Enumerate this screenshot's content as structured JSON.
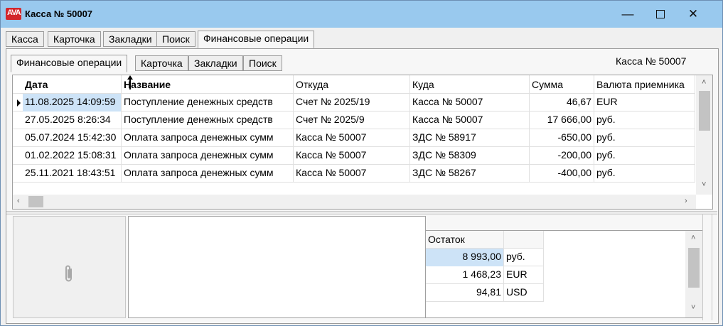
{
  "window": {
    "title": "Касса № 50007",
    "logo_text": "AVA",
    "controls": {
      "minimize": "—",
      "close": "✕"
    }
  },
  "outer_tabs": [
    "Касса",
    "Карточка",
    "Закладки",
    "Поиск",
    "Финансовые операции"
  ],
  "outer_active": "Финансовые операции",
  "inner_tabs": [
    "Финансовые операции",
    "Карточка",
    "Закладки",
    "Поиск"
  ],
  "inner_active": "Финансовые операции",
  "caption": "Касса № 50007",
  "grid": {
    "columns": [
      "Дата",
      "Название",
      "Откуда",
      "Куда",
      "Сумма",
      "Валюта приемника"
    ],
    "sorted_column": "Название",
    "rows": [
      [
        "11.08.2025 14:09:59",
        "Поступление денежных средств",
        "Счет № 2025/19",
        "Касса № 50007",
        "46,67",
        "EUR"
      ],
      [
        "27.05.2025 8:26:34",
        "Поступление денежных средств",
        "Счет № 2025/9",
        "Касса № 50007",
        "17 666,00",
        "руб."
      ],
      [
        "05.07.2024 15:42:30",
        "Оплата запроса денежных сумм",
        "Касса № 50007",
        "ЗДС № 58917",
        "-650,00",
        "руб."
      ],
      [
        "01.02.2022 15:08:31",
        "Оплата запроса денежных сумм",
        "Касса № 50007",
        "ЗДС № 58309",
        "-200,00",
        "руб."
      ],
      [
        "25.11.2021 18:43:51",
        "Оплата запроса денежных сумм",
        "Касса № 50007",
        "ЗДС № 58267",
        "-400,00",
        "руб."
      ]
    ],
    "selected_row": 0
  },
  "balance": {
    "header": "Остаток",
    "rows": [
      [
        "8 993,00",
        "руб."
      ],
      [
        "1 468,23",
        "EUR"
      ],
      [
        "94,81",
        "USD"
      ]
    ]
  },
  "icons": {
    "app": "app-logo-icon",
    "attachment": "paperclip-icon"
  },
  "colors": {
    "titlebar": "#99c9ee",
    "selection": "#cde3f7",
    "logo": "#d3262b"
  }
}
